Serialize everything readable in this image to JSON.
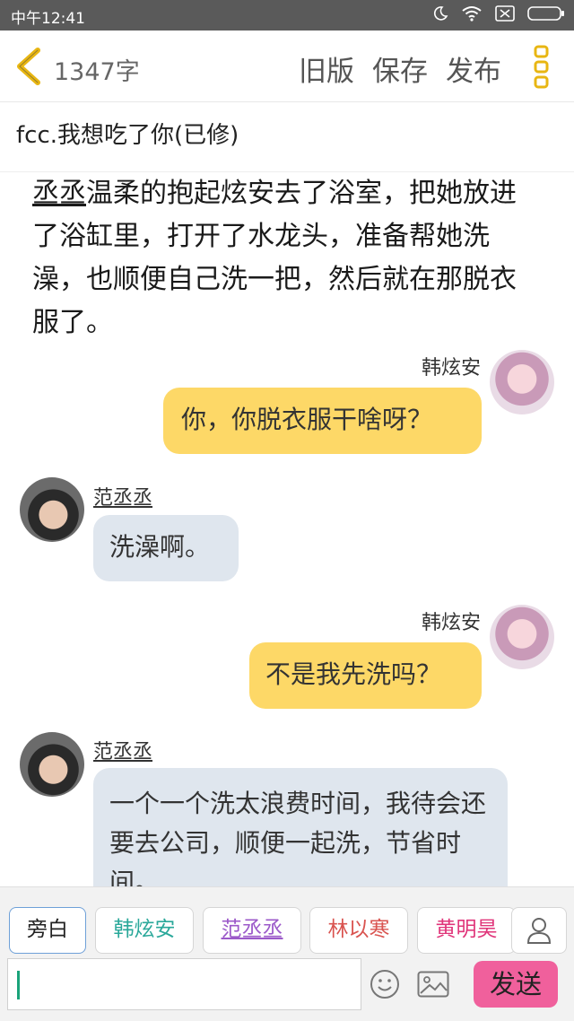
{
  "status_bar": {
    "time": "中午12:41"
  },
  "toolbar": {
    "word_count": "1347字",
    "old_version": "旧版",
    "save": "保存",
    "publish": "发布"
  },
  "story": {
    "title": "fcc.我想吃了你(已修)"
  },
  "narration": {
    "highlight": "丞丞",
    "rest": "温柔的抱起炫安去了浴室，把她放进了浴缸里，打开了水龙头，准备帮她洗澡，也顺便自己洗一把，然后就在那脱衣服了。"
  },
  "messages": [
    {
      "speaker": "韩炫安",
      "text": "你，你脱衣服干啥呀？"
    },
    {
      "speaker": "范丞丞",
      "text": "洗澡啊。"
    },
    {
      "speaker": "韩炫安",
      "text": "不是我先洗吗？"
    },
    {
      "speaker": "范丞丞",
      "text": "一个一个洗太浪费时间，我待会还要去公司，顺便一起洗，节省时间。"
    }
  ],
  "roles": [
    {
      "label": "旁白",
      "color": "#555555"
    },
    {
      "label": "韩炫安",
      "color": "#2aa89a"
    },
    {
      "label": "范丞丞",
      "color": "#9b59c9"
    },
    {
      "label": "林以寒",
      "color": "#d9534f"
    },
    {
      "label": "黄明昊",
      "color": "#e0357a"
    }
  ],
  "composer": {
    "send": "发送"
  },
  "colors": {
    "accent_yellow": "#f0c419",
    "bubble_right": "#fdd867",
    "bubble_left": "#dfe6ee",
    "send_button": "#f0609c"
  },
  "icons": [
    "moon-icon",
    "wifi-icon",
    "sim-icon",
    "battery-icon",
    "back-chevron-icon",
    "more-icon",
    "user-icon",
    "emoji-icon",
    "image-icon"
  ]
}
